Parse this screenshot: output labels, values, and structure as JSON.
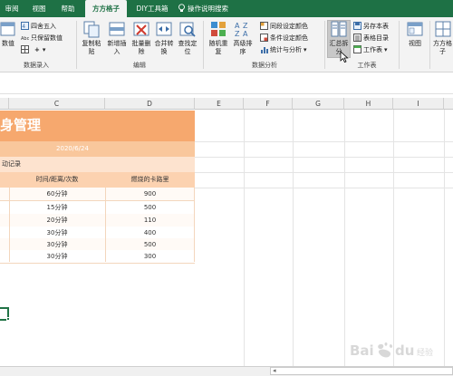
{
  "tabs": {
    "review": "审阅",
    "view": "视图",
    "help": "帮助",
    "fangfang": "方方格子",
    "diy": "DIY工具箱",
    "tell_me": "操作说明搜索"
  },
  "ribbon": {
    "data_entry": {
      "number_btn": "数值",
      "round_btn": "四舍五入",
      "keep_values_btn": "只保留数值",
      "plus_btn": "+",
      "group_label": "数据录入"
    },
    "edit": {
      "copy_paste": [
        "复制粘",
        "贴"
      ],
      "insert": [
        "新增插",
        "入"
      ],
      "batch_delete": [
        "批量删",
        "除"
      ],
      "merge_convert": [
        "合并转",
        "换"
      ],
      "find_locate": [
        "查找定",
        "位"
      ],
      "group_label": "编辑"
    },
    "analysis": {
      "random_repeat": [
        "随机重",
        "复"
      ],
      "advanced_sort": [
        "高级排",
        "序"
      ],
      "dup_color": "同段设定颜色",
      "cond_color": "条件设定颜色",
      "stats": "统计与分析",
      "group_label": "数据分析"
    },
    "worksheet": {
      "summarize_split": [
        "汇总拆",
        "分"
      ],
      "save_as_sheet": "另存本表",
      "sheet_catalog": "表格目录",
      "worksheet_menu": "工作表",
      "group_label": "工作表"
    },
    "view_btn": "视图",
    "fangfang_btn": [
      "方方格",
      "子"
    ]
  },
  "columns": [
    "C",
    "D",
    "E",
    "F",
    "G",
    "H",
    "I"
  ],
  "sheet": {
    "title": "身管理",
    "date": "2020/6/24",
    "section_label": "动记录",
    "headers": [
      "时间/距离/次数",
      "燃烧的卡路里"
    ],
    "rows": [
      [
        "60分钟",
        "900"
      ],
      [
        "15分钟",
        "500"
      ],
      [
        "20分钟",
        "110"
      ],
      [
        "30分钟",
        "400"
      ],
      [
        "30分钟",
        "500"
      ],
      [
        "30分钟",
        "300"
      ]
    ]
  },
  "watermark": "Bai du 经验",
  "colors": {
    "ribbon_green": "#1e7145",
    "banner_orange": "#f6a86e",
    "date_band": "#f9c79c",
    "header_band": "#fcd2b0",
    "section_band": "#fde3cf"
  }
}
